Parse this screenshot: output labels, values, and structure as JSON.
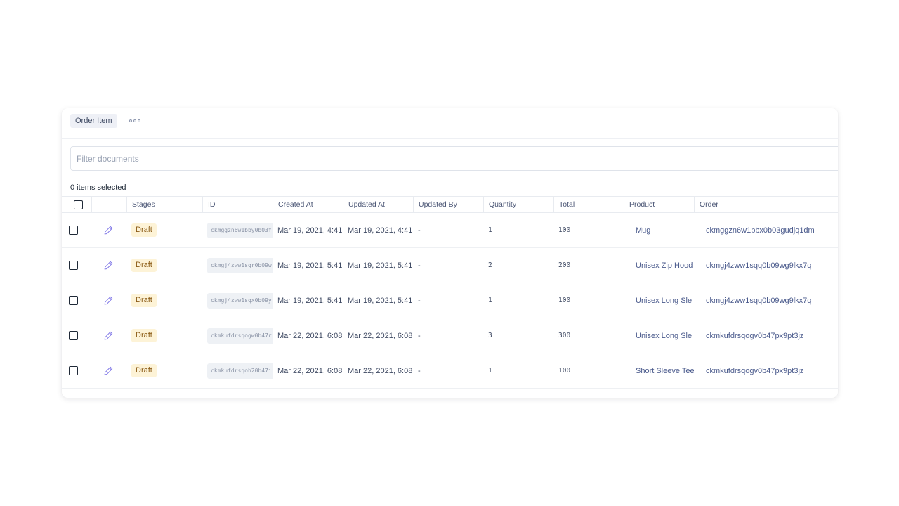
{
  "model": {
    "tab_label": "Order Item",
    "more_icon": "more-horizontal-icon"
  },
  "filter": {
    "placeholder": "Filter documents",
    "value": ""
  },
  "selection": {
    "label": "0 items selected"
  },
  "table": {
    "columns": [
      "Stages",
      "ID",
      "Created At",
      "Updated At",
      "Updated By",
      "Quantity",
      "Total",
      "Product",
      "Order"
    ],
    "rows": [
      {
        "stage": "Draft",
        "id": "ckmggzn6w1bby0b03f",
        "created": "Mar 19, 2021, 4:41",
        "updated": "Mar 19, 2021, 4:41",
        "updated_by": "-",
        "quantity": "1",
        "total": "100",
        "product": "Mug",
        "order": "ckmggzn6w1bbx0b03gudjq1dm"
      },
      {
        "stage": "Draft",
        "id": "ckmgj4zww1sqr0b09w",
        "created": "Mar 19, 2021, 5:41",
        "updated": "Mar 19, 2021, 5:41",
        "updated_by": "-",
        "quantity": "2",
        "total": "200",
        "product": "Unisex Zip Hood",
        "order": "ckmgj4zww1sqq0b09wg9lkx7q"
      },
      {
        "stage": "Draft",
        "id": "ckmgj4zww1sqx0b09y",
        "created": "Mar 19, 2021, 5:41",
        "updated": "Mar 19, 2021, 5:41",
        "updated_by": "-",
        "quantity": "1",
        "total": "100",
        "product": "Unisex Long Sle",
        "order": "ckmgj4zww1sqq0b09wg9lkx7q"
      },
      {
        "stage": "Draft",
        "id": "ckmkufdrsqogw0b47r",
        "created": "Mar 22, 2021, 6:08",
        "updated": "Mar 22, 2021, 6:08",
        "updated_by": "-",
        "quantity": "3",
        "total": "300",
        "product": "Unisex Long Sle",
        "order": "ckmkufdrsqogv0b47px9pt3jz"
      },
      {
        "stage": "Draft",
        "id": "ckmkufdrsqoh20b47i",
        "created": "Mar 22, 2021, 6:08",
        "updated": "Mar 22, 2021, 6:08",
        "updated_by": "-",
        "quantity": "1",
        "total": "100",
        "product": "Short Sleeve Tee",
        "order": "ckmkufdrsqogv0b47px9pt3jz"
      }
    ]
  },
  "colors": {
    "draft_badge_bg": "#fdf3d7",
    "draft_badge_text": "#8a5a14",
    "edit_icon": "#7b72e6",
    "link_text": "#4a5a8c"
  }
}
